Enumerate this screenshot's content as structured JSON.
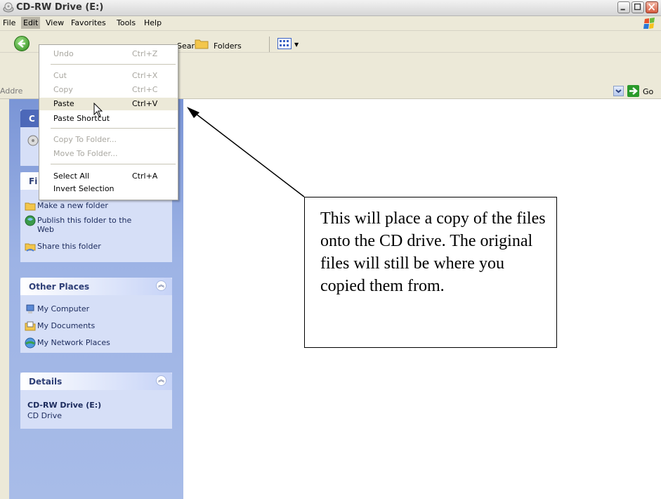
{
  "window": {
    "title": "CD-RW Drive (E:)"
  },
  "menubar": {
    "items": [
      "File",
      "Edit",
      "View",
      "Favorites",
      "Tools",
      "Help"
    ],
    "active": "Edit"
  },
  "toolbar": {
    "search_label": "Search",
    "folders_label": "Folders"
  },
  "address": {
    "label": "Addre",
    "go_label": "Go"
  },
  "edit_menu": {
    "items": [
      {
        "label": "Undo",
        "shortcut": "Ctrl+Z",
        "disabled": true
      },
      {
        "label": "Cut",
        "shortcut": "Ctrl+X",
        "disabled": true
      },
      {
        "label": "Copy",
        "shortcut": "Ctrl+C",
        "disabled": true
      },
      {
        "label": "Paste",
        "shortcut": "Ctrl+V",
        "disabled": false,
        "hover": true
      },
      {
        "label": "Paste Shortcut",
        "shortcut": "",
        "disabled": false
      },
      {
        "label": "Copy To Folder...",
        "shortcut": "",
        "disabled": true
      },
      {
        "label": "Move To Folder...",
        "shortcut": "",
        "disabled": true
      },
      {
        "label": "Select All",
        "shortcut": "Ctrl+A",
        "disabled": false
      },
      {
        "label": "Invert Selection",
        "shortcut": "",
        "disabled": false
      }
    ]
  },
  "taskpane": {
    "cd_tasks": {
      "title": "C",
      "icon": "cd-icon"
    },
    "file_tasks": {
      "title": "Fi",
      "items": [
        {
          "label": "Make a new folder",
          "icon": "new-folder-icon"
        },
        {
          "label": "Publish this folder to the",
          "label2": "Web",
          "icon": "publish-web-icon"
        },
        {
          "label": "Share this folder",
          "icon": "share-folder-icon"
        }
      ]
    },
    "other_places": {
      "title": "Other Places",
      "items": [
        {
          "label": "My Computer",
          "icon": "my-computer-icon"
        },
        {
          "label": "My Documents",
          "icon": "my-documents-icon"
        },
        {
          "label": "My Network Places",
          "icon": "network-places-icon"
        }
      ]
    },
    "details": {
      "title": "Details",
      "name": "CD-RW Drive (E:)",
      "type": "CD Drive"
    }
  },
  "annotation": {
    "text": "This will place a copy of the files onto the CD drive. The original files will still be where you copied them from."
  },
  "colors": {
    "taskpane_blue": "#7a95d6",
    "panel_bg": "#d6dff7",
    "menu_bg": "#ece9d8",
    "close_red": "#d65a3d"
  }
}
